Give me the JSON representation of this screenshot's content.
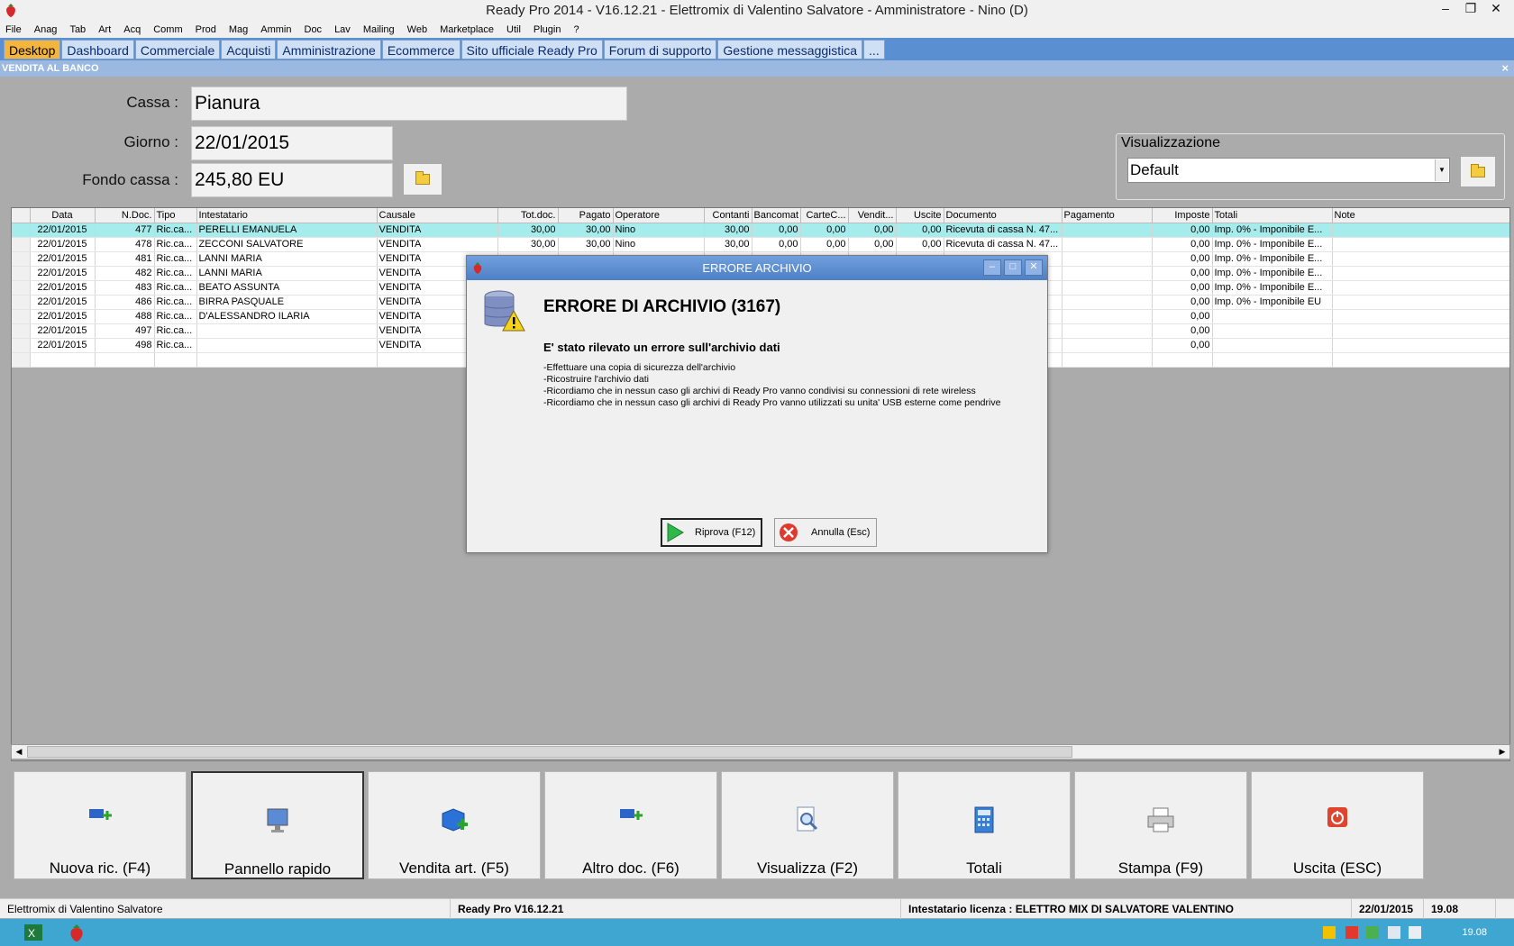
{
  "window": {
    "title": "Ready Pro 2014 - V16.12.21 - Elettromix di Valentino Salvatore - Amministratore - Nino (D)"
  },
  "menu": [
    "File",
    "Anag",
    "Tab",
    "Art",
    "Acq",
    "Comm",
    "Prod",
    "Mag",
    "Ammin",
    "Doc",
    "Lav",
    "Mailing",
    "Web",
    "Marketplace",
    "Util",
    "Plugin",
    "?"
  ],
  "tabs": [
    "Desktop",
    "Dashboard",
    "Commerciale",
    "Acquisti",
    "Amministrazione",
    "Ecommerce",
    "Sito ufficiale Ready Pro",
    "Forum di supporto",
    "Gestione messaggistica",
    "..."
  ],
  "section": {
    "title": "VENDITA AL BANCO",
    "close": "×"
  },
  "form": {
    "cassa_label": "Cassa :",
    "cassa_value": "Pianura",
    "giorno_label": "Giorno :",
    "giorno_value": "22/01/2015",
    "fondo_label": "Fondo cassa :",
    "fondo_value": "245,80 EU"
  },
  "visualizzazione": {
    "label": "Visualizzazione",
    "value": "Default"
  },
  "grid": {
    "columns": [
      "Data",
      "N.Doc.",
      "Tipo",
      "Intestatario",
      "Causale",
      "Tot.doc.",
      "Pagato",
      "Operatore",
      "Contanti",
      "Bancomat",
      "CarteC...",
      "Vendit...",
      "Uscite",
      "Documento",
      "Pagamento",
      "Imposte",
      "Totali",
      "Note"
    ],
    "rows": [
      [
        "22/01/2015",
        "477",
        "Ric.ca...",
        "PERELLI EMANUELA",
        "VENDITA",
        "30,00",
        "30,00",
        "Nino",
        "30,00",
        "0,00",
        "0,00",
        "0,00",
        "0,00",
        "Ricevuta di cassa N. 47...",
        "",
        "0,00",
        "Imp. 0% - Imponibile E...",
        ""
      ],
      [
        "22/01/2015",
        "478",
        "Ric.ca...",
        "ZECCONI SALVATORE",
        "VENDITA",
        "30,00",
        "30,00",
        "Nino",
        "30,00",
        "0,00",
        "0,00",
        "0,00",
        "0,00",
        "Ricevuta di cassa N. 47...",
        "",
        "0,00",
        "Imp. 0% - Imponibile E...",
        ""
      ],
      [
        "22/01/2015",
        "481",
        "Ric.ca...",
        "LANNI MARIA",
        "VENDITA",
        "",
        "",
        "",
        "",
        "",
        "",
        "",
        "",
        "...",
        "",
        "0,00",
        "Imp. 0% - Imponibile E...",
        ""
      ],
      [
        "22/01/2015",
        "482",
        "Ric.ca...",
        "LANNI MARIA",
        "VENDITA",
        "",
        "",
        "",
        "",
        "",
        "",
        "",
        "",
        "...",
        "",
        "0,00",
        "Imp. 0% - Imponibile E...",
        ""
      ],
      [
        "22/01/2015",
        "483",
        "Ric.ca...",
        "BEATO ASSUNTA",
        "VENDITA",
        "",
        "",
        "",
        "",
        "",
        "",
        "",
        "",
        "...",
        "",
        "0,00",
        "Imp. 0% - Imponibile E...",
        ""
      ],
      [
        "22/01/2015",
        "486",
        "Ric.ca...",
        "BIRRA PASQUALE",
        "VENDITA",
        "",
        "",
        "",
        "",
        "",
        "",
        "",
        "",
        "...",
        "",
        "0,00",
        "Imp. 0% - Imponibile EU",
        ""
      ],
      [
        "22/01/2015",
        "488",
        "Ric.ca...",
        "D'ALESSANDRO ILARIA",
        "VENDITA",
        "",
        "",
        "",
        "",
        "",
        "",
        "",
        "",
        "...",
        "",
        "0,00",
        "",
        ""
      ],
      [
        "22/01/2015",
        "497",
        "Ric.ca...",
        "",
        "VENDITA",
        "",
        "",
        "",
        "",
        "",
        "",
        "",
        "",
        "...",
        "",
        "0,00",
        "",
        ""
      ],
      [
        "22/01/2015",
        "498",
        "Ric.ca...",
        "",
        "VENDITA",
        "",
        "",
        "",
        "",
        "",
        "",
        "",
        "",
        "...",
        "",
        "0,00",
        "",
        ""
      ]
    ]
  },
  "dialog": {
    "title": "ERRORE ARCHIVIO",
    "heading": "ERRORE DI ARCHIVIO (3167)",
    "subheading": "E' stato rilevato un errore sull'archivio dati",
    "lines": [
      "-Effettuare una copia di sicurezza dell'archivio",
      "-Ricostruire l'archivio dati",
      "-Ricordiamo che in nessun caso gli archivi di Ready Pro vanno condivisi su connessioni di rete wireless",
      "-Ricordiamo che in nessun caso gli archivi di Ready Pro vanno utilizzati su unita' USB esterne come pendrive"
    ],
    "retry_label": "Riprova (F12)",
    "cancel_label": "Annulla (Esc)"
  },
  "actions": [
    {
      "label": "Nuova ric. (F4)",
      "icon": "add-doc-icon"
    },
    {
      "label": "Pannello rapido",
      "icon": "monitor-icon"
    },
    {
      "label": "Vendita art. (F5)",
      "icon": "box-add-icon"
    },
    {
      "label": "Altro doc. (F6)",
      "icon": "add-doc-icon"
    },
    {
      "label": "Visualizza (F2)",
      "icon": "magnifier-icon"
    },
    {
      "label": "Totali",
      "icon": "calculator-icon"
    },
    {
      "label": "Stampa (F9)",
      "icon": "printer-icon"
    },
    {
      "label": "Uscita (ESC)",
      "icon": "power-icon"
    }
  ],
  "status": {
    "company": "Elettromix di Valentino Salvatore",
    "version": "Ready Pro V16.12.21",
    "license": "Intestatario licenza : ELETTRO MIX DI SALVATORE VALENTINO",
    "date": "22/01/2015",
    "time": "19.08"
  },
  "taskbar": {
    "clock": "19.08"
  },
  "colors": {
    "accent": "#5a8fd1",
    "active_tab": "#f4b53c",
    "selected_row": "#a7ecec",
    "taskbar": "#3fa6d2"
  }
}
